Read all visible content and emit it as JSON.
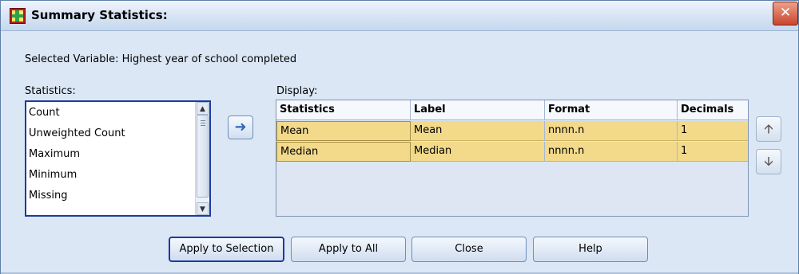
{
  "window": {
    "title": "Summary Statistics:",
    "close_glyph": "✕"
  },
  "selected_variable_text": "Selected Variable: Highest year of school completed",
  "statistics": {
    "label": "Statistics:",
    "items": [
      "Count",
      "Unweighted Count",
      "Maximum",
      "Minimum",
      "Missing"
    ]
  },
  "move_button_glyph": "➜",
  "display": {
    "label": "Display:",
    "columns": [
      "Statistics",
      "Label",
      "Format",
      "Decimals"
    ],
    "rows": [
      {
        "statistics": "Mean",
        "label": "Mean",
        "format": "nnnn.n",
        "decimals": "1"
      },
      {
        "statistics": "Median",
        "label": "Median",
        "format": "nnnn.n",
        "decimals": "1"
      }
    ],
    "row_highlight_color": "#f3d98a"
  },
  "reorder": {
    "up_glyph": "🡩",
    "down_glyph": "🡫"
  },
  "buttons": {
    "apply_to_selection": "Apply to Selection",
    "apply_to_all": "Apply to All",
    "close": "Close",
    "help": "Help"
  },
  "icons": {
    "app": "spss-table-icon",
    "close": "close-icon",
    "move": "right-arrow-icon",
    "up": "up-arrow-icon",
    "down": "down-arrow-icon"
  }
}
